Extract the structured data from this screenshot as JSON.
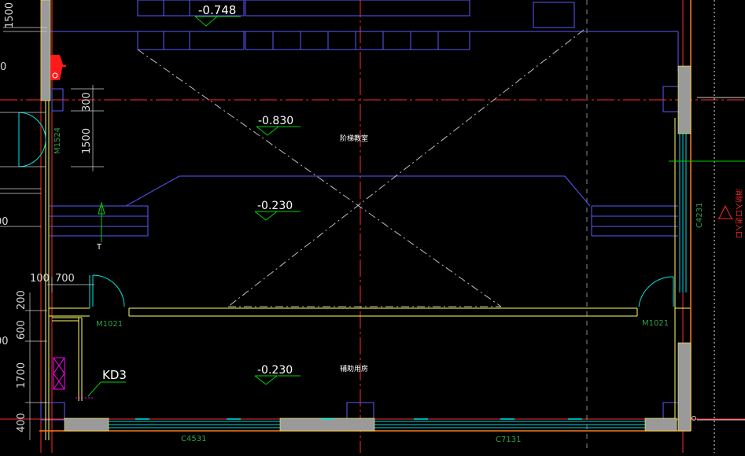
{
  "elevations": [
    {
      "value": "-0.748"
    },
    {
      "value": "-0.830"
    },
    {
      "value": "-0.230"
    },
    {
      "value": "-0.230"
    }
  ],
  "room_labels": [
    {
      "text": "阶梯教室"
    },
    {
      "text": "辅助用房"
    }
  ],
  "door_labels": [
    "M1524",
    "M1021",
    "M1021"
  ],
  "window_labels": [
    "C4531",
    "C7131",
    "C4231"
  ],
  "dimensions": [
    "1500",
    "300",
    "1500",
    "100",
    "700",
    "200",
    "600",
    "1700",
    "400",
    "0",
    "00",
    "00"
  ],
  "markers": {
    "kd": "KD3",
    "up_arrow": "T"
  },
  "side_note": "消防入口进入口",
  "colors": {
    "background": "#000000",
    "wall": "#ffff66",
    "axis": "#ff2a2a",
    "outline": "#5a5aff",
    "dim_text": "#d9d9d9",
    "elevation_text": "#ffffff",
    "elevation_marker": "#00d000",
    "door": "#00e6e6",
    "hatch": "#9a9a9a",
    "magenta": "#ff00ff",
    "dash": "#c8c8c8",
    "label_green": "#2fa04a"
  }
}
